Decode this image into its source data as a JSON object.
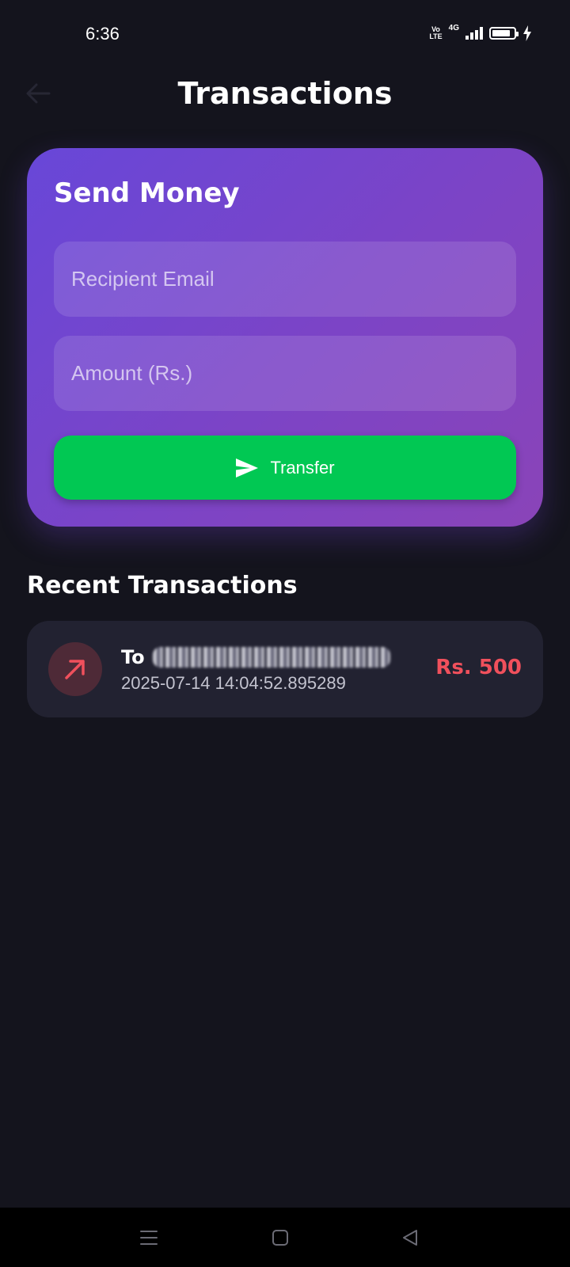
{
  "status_bar": {
    "time": "6:36",
    "volte_top": "Vo",
    "volte_bottom": "LTE",
    "network": "4G",
    "battery_level": 0.85
  },
  "header": {
    "title": "Transactions",
    "back_icon": "arrow-left-icon"
  },
  "send_money": {
    "title": "Send Money",
    "recipient_placeholder": "Recipient Email",
    "amount_placeholder": "Amount (Rs.)",
    "transfer_label": "Transfer",
    "transfer_icon": "send-icon"
  },
  "recent": {
    "title": "Recent Transactions",
    "transactions": [
      {
        "direction": "outgoing",
        "icon": "arrow-up-right-icon",
        "title_prefix": "To",
        "recipient_redacted": true,
        "timestamp": "2025-07-14 14:04:52.895289",
        "amount": "Rs. 500"
      }
    ]
  },
  "nav_bar": {
    "menu_icon": "menu-icon",
    "home_icon": "square-home-icon",
    "back_icon": "triangle-back-icon"
  },
  "colors": {
    "background": "#14141d",
    "card_gradient_start": "#6847d8",
    "card_gradient_end": "#8a44b8",
    "transfer_green": "#01c853",
    "outgoing_red": "#f0505c",
    "tx_card": "#222231"
  }
}
